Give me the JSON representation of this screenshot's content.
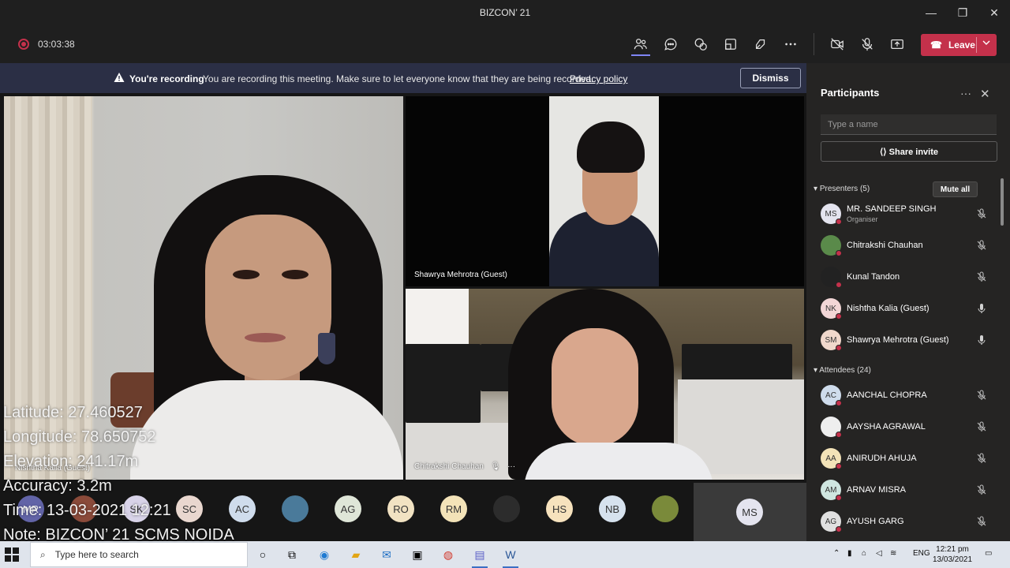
{
  "window": {
    "title": "BIZCON’ 21",
    "minimize": "—",
    "maximize": "❐",
    "close": "✕"
  },
  "meeting_bar": {
    "timer": "03:03:38",
    "leave_label": "Leave",
    "leave_icon": "phone-hangup-icon",
    "toolbar_icons": [
      "people-icon",
      "chat-icon",
      "reactions-icon",
      "rooms-icon",
      "apps-icon",
      "more-icon",
      "camera-off-icon",
      "mic-off-icon",
      "share-screen-icon"
    ],
    "accent": "#c4314b"
  },
  "banner": {
    "title": "You're recording",
    "message": "You are recording this meeting. Make sure to let everyone know that they are being recorded.",
    "link": "Privacy policy",
    "dismiss": "Dismiss"
  },
  "tiles": {
    "nishtha_label": "Nishtha Kalia (Guest)",
    "shawrya_label": "Shawrya Mehrotra (Guest)",
    "chitrakshi_label": "Chitrakshi Chauhan",
    "chitrakshi_more": "···"
  },
  "overlay": {
    "latitude": "Latitude: 27.460527",
    "longitude": "Longitude: 78.650752",
    "elevation": "Elevation: 241.17m",
    "accuracy": "Accuracy: 3.2m",
    "time": "Time: 13-03-2021 12:21",
    "note": "Note: BIZCON’ 21 SCMS NOIDA"
  },
  "avatar_row": [
    {
      "initials": "MR",
      "color": "#6264a7"
    },
    {
      "initials": "",
      "color": "#8a4a3a"
    },
    {
      "initials": "SK",
      "color": "#d8d3e8"
    },
    {
      "initials": "SC",
      "color": "#e9d7cf"
    },
    {
      "initials": "AC",
      "color": "#cfdcec"
    },
    {
      "initials": "",
      "color": "#4a7a9a"
    },
    {
      "initials": "AG",
      "color": "#dfe6d8"
    },
    {
      "initials": "RO",
      "color": "#f1e2c2"
    },
    {
      "initials": "RM",
      "color": "#f3e3b8"
    },
    {
      "initials": "",
      "color": "#2c2c2c"
    },
    {
      "initials": "HS",
      "color": "#f6e2bd"
    },
    {
      "initials": "NB",
      "color": "#d6e2ee"
    },
    {
      "initials": "",
      "color": "#7a8a3a"
    }
  ],
  "ms_tile": {
    "initials": "MS",
    "color": "#e4e4ef"
  },
  "panel": {
    "title": "Participants",
    "more": "···",
    "close": "✕",
    "search_placeholder": "Type a name",
    "share_invite": "Share invite",
    "presenters_header": "Presenters (5)",
    "mute_all": "Mute all",
    "attendees_header": "Attendees (24)",
    "presenters": [
      {
        "initials": "MS",
        "name": "MR. SANDEEP SINGH",
        "role": "Organiser",
        "color": "#e4e4ef",
        "mic": "mic-off-icon"
      },
      {
        "initials": "",
        "name": "Chitrakshi Chauhan",
        "role": "",
        "color": "#5a8a4a",
        "mic": "mic-off-icon"
      },
      {
        "initials": "",
        "name": "Kunal Tandon",
        "role": "",
        "color": "#222222",
        "mic": "mic-off-icon"
      },
      {
        "initials": "NK",
        "name": "Nishtha Kalia (Guest)",
        "role": "",
        "color": "#f2d6d6",
        "mic": "mic-on-icon"
      },
      {
        "initials": "SM",
        "name": "Shawrya Mehrotra (Guest)",
        "role": "",
        "color": "#f0d8cc",
        "mic": "mic-on-icon"
      }
    ],
    "attendees": [
      {
        "initials": "AC",
        "name": "AANCHAL CHOPRA",
        "color": "#cfdcec",
        "mic": "mic-off-icon"
      },
      {
        "initials": "",
        "name": "AAYSHA AGRAWAL",
        "color": "#eeeeee",
        "mic": "mic-off-icon"
      },
      {
        "initials": "AA",
        "name": "ANIRUDH AHUJA",
        "color": "#f3e3b8",
        "mic": "mic-off-icon"
      },
      {
        "initials": "AM",
        "name": "ARNAV MISRA",
        "color": "#cfe6e0",
        "mic": "mic-off-icon"
      },
      {
        "initials": "AG",
        "name": "AYUSH GARG",
        "color": "#e0e0e0",
        "mic": "mic-off-icon"
      }
    ]
  },
  "taskbar": {
    "search_placeholder": "Type here to search",
    "apps": [
      "cortana-icon",
      "task-view-icon",
      "edge-icon",
      "file-explorer-icon",
      "mail-icon",
      "vlc-icon",
      "chrome-icon",
      "teams-icon",
      "word-icon"
    ],
    "tray_lang": "ENG",
    "time": "12:21 pm",
    "date": "13/03/2021"
  }
}
